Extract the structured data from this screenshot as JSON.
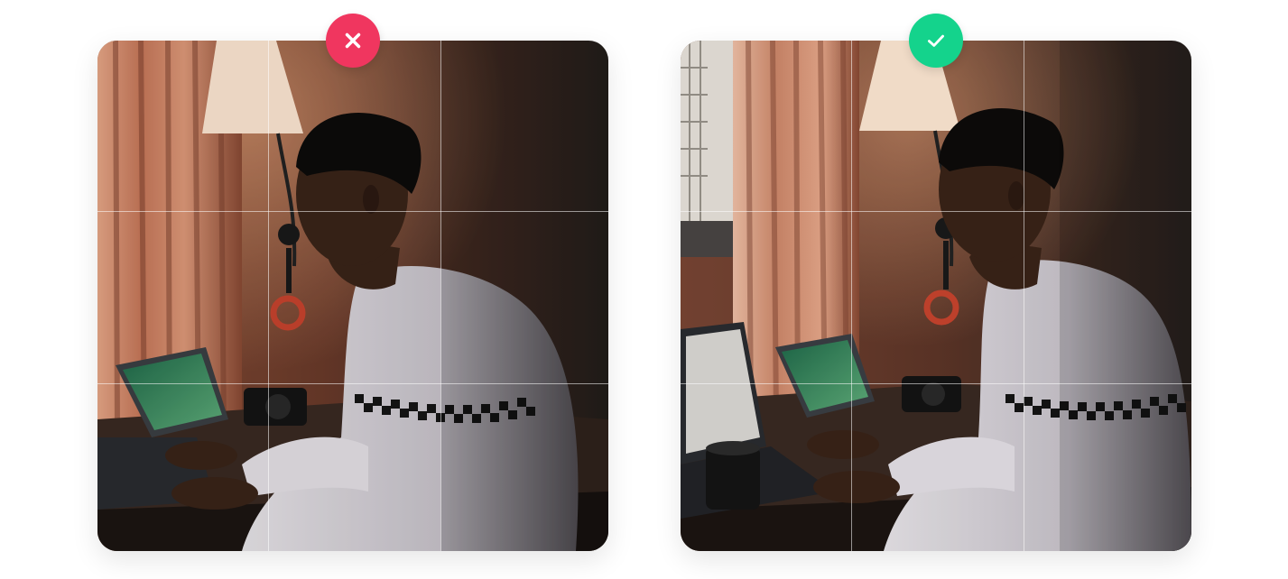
{
  "colors": {
    "reject": "#f0365f",
    "accept": "#14d38c",
    "grid": "rgba(255,255,255,0.55)"
  },
  "images": [
    {
      "id": "bad",
      "status": "rejected",
      "icon": "close-icon",
      "grid": "rule-of-thirds"
    },
    {
      "id": "good",
      "status": "accepted",
      "icon": "check-icon",
      "grid": "rule-of-thirds"
    }
  ]
}
